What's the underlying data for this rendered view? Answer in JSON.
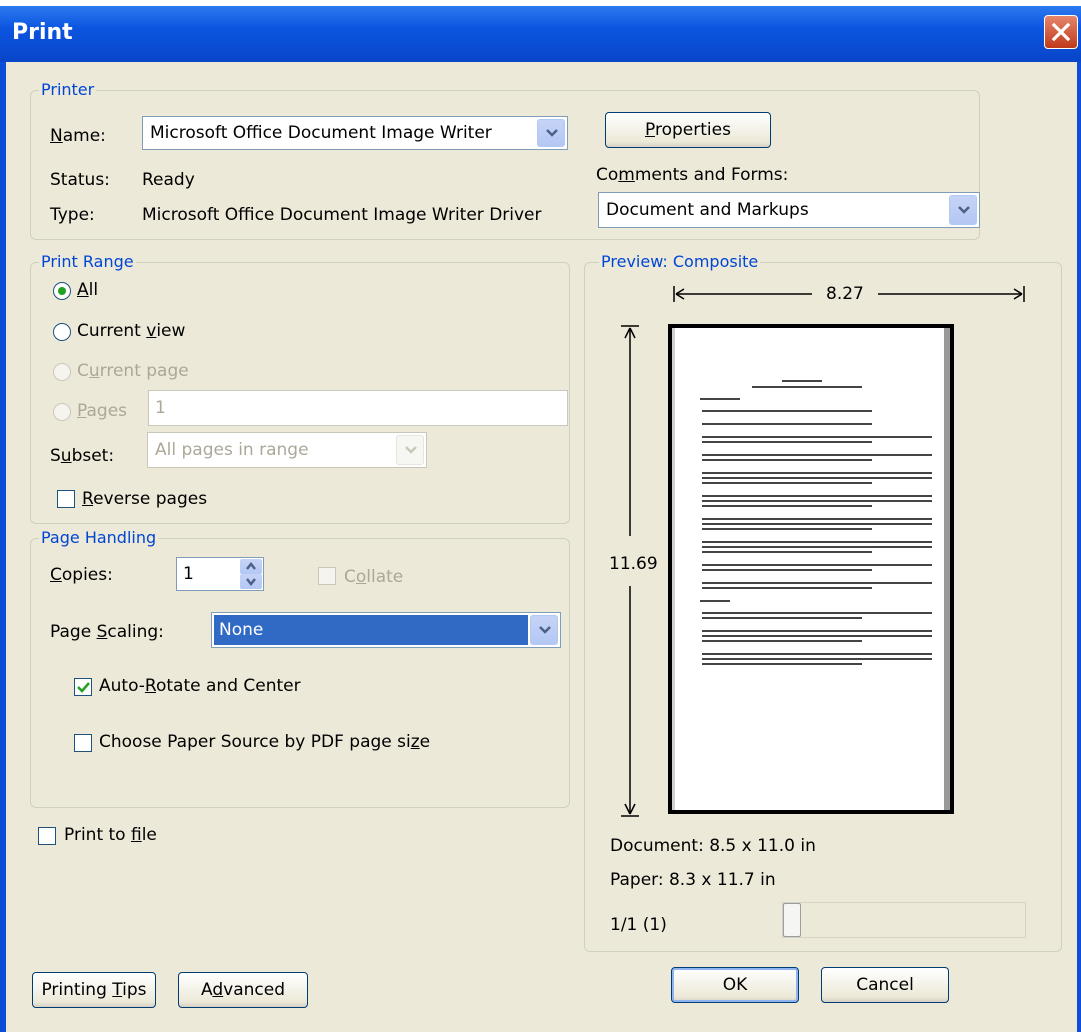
{
  "window": {
    "title": "Print"
  },
  "printer": {
    "legend": "Printer",
    "name_label": "Name:",
    "name_value": "Microsoft Office Document Image Writer",
    "status_label": "Status:",
    "status_value": "Ready",
    "type_label": "Type:",
    "type_value": "Microsoft Office Document Image Writer Driver",
    "properties_button": "Properties",
    "comments_label": "Comments and Forms:",
    "comments_value": "Document and Markups"
  },
  "print_range": {
    "legend": "Print Range",
    "all": "All",
    "current_view": "Current view",
    "current_page": "Current page",
    "pages": "Pages",
    "pages_value": "1",
    "subset_label": "Subset:",
    "subset_value": "All pages in range",
    "reverse_pages": "Reverse pages",
    "selected": "all"
  },
  "page_handling": {
    "legend": "Page Handling",
    "copies_label": "Copies:",
    "copies_value": "1",
    "collate": "Collate",
    "scaling_label": "Page Scaling:",
    "scaling_value": "None",
    "auto_rotate": "Auto-Rotate and Center",
    "auto_rotate_checked": true,
    "paper_source": "Choose Paper Source by PDF page size",
    "paper_source_checked": false
  },
  "print_to_file": {
    "label": "Print to file",
    "checked": false
  },
  "preview": {
    "legend": "Preview: Composite",
    "width": "8.27",
    "height": "11.69",
    "document_size": "Document: 8.5 x 11.0 in",
    "paper_size": "Paper: 8.3 x 11.7 in",
    "page_counter": "1/1 (1)"
  },
  "buttons": {
    "printing_tips": "Printing Tips",
    "advanced": "Advanced",
    "ok": "OK",
    "cancel": "Cancel"
  },
  "colors": {
    "title_bar": "#0b55df",
    "group_label": "#0046d5",
    "dialog_bg": "#ece9d8",
    "selection": "#316ac5"
  },
  "icons": [
    "close-icon",
    "dropdown-arrow-icon",
    "checkmark-icon",
    "spin-up-icon",
    "spin-down-icon"
  ]
}
